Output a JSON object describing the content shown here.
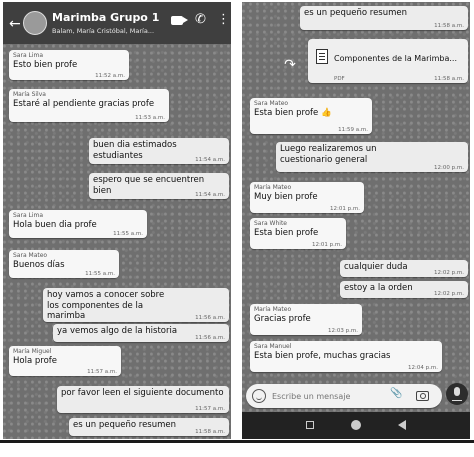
{
  "header": {
    "group_name": "Marimba Grupo 1",
    "members": "Balam, María Cristóbal, María..."
  },
  "left_messages": [
    {
      "sender": "Sara Lima",
      "text": "Esto bien profe",
      "time": "11:52 a.m."
    },
    {
      "sender": "María Silva",
      "text": "Estaré al pendiente gracias profe",
      "time": "11:53 a.m."
    },
    {
      "sender": "",
      "text": "buen dia estimados estudiantes",
      "time": "11:54 a.m."
    },
    {
      "sender": "",
      "text": "espero que se encuentren bien",
      "time": "11:54 a.m."
    },
    {
      "sender": "Sara Lima",
      "text": "Hola buen dia profe",
      "time": "11:55 a.m."
    },
    {
      "sender": "Sara Mateo",
      "text": "Buenos días",
      "time": "11:55 a.m."
    },
    {
      "sender": "",
      "text": "hoy vamos a conocer sobre los componentes de la marimba",
      "time": "11:56 a.m."
    },
    {
      "sender": "",
      "text": "ya vemos algo de la historia",
      "time": "11:56 a.m."
    },
    {
      "sender": "María Miguel",
      "text": "Hola profe",
      "time": "11:57 a.m."
    },
    {
      "sender": "",
      "text": "por favor leen el siguiente documento",
      "time": "11:57 a.m."
    },
    {
      "sender": "",
      "text": "es un pequeño resumen",
      "time": "11:58 a.m."
    }
  ],
  "right_messages": [
    {
      "sender": "",
      "text": "es un pequeño resumen",
      "time": "11:58 a.m."
    },
    {
      "sender": "Sara Mateo",
      "text": "Esta bien profe 👍",
      "time": "11:59 a.m."
    },
    {
      "sender": "",
      "text": "Luego realizaremos un cuestionario general",
      "time": "12:00 p.m."
    },
    {
      "sender": "María Mateo",
      "text": "Muy bien profe",
      "time": "12:01 p.m."
    },
    {
      "sender": "Sara White",
      "text": "Esta bien profe",
      "time": "12:01 p.m."
    },
    {
      "sender": "",
      "text": "cualquier duda",
      "time": "12:02 p.m."
    },
    {
      "sender": "",
      "text": "estoy a la orden",
      "time": "12:02 p.m."
    },
    {
      "sender": "María Mateo",
      "text": "Gracias profe",
      "time": "12:03 p.m."
    },
    {
      "sender": "Sara Manuel",
      "text": "Esta bien profe, muchas gracias",
      "time": "12:04 p.m."
    }
  ],
  "attachment": {
    "name": "Componentes de la Marimba...",
    "meta": "PDF",
    "time": "11:58 a.m.",
    "icon": "document-icon"
  },
  "input": {
    "placeholder": "Escribe un mensaje"
  },
  "colors": {
    "header": "#3f3f3f",
    "chat_background": "#6f6f6f",
    "bubble_in": "#f7f7f7",
    "bubble_out": "#ececec",
    "nav_bar": "#222222"
  }
}
